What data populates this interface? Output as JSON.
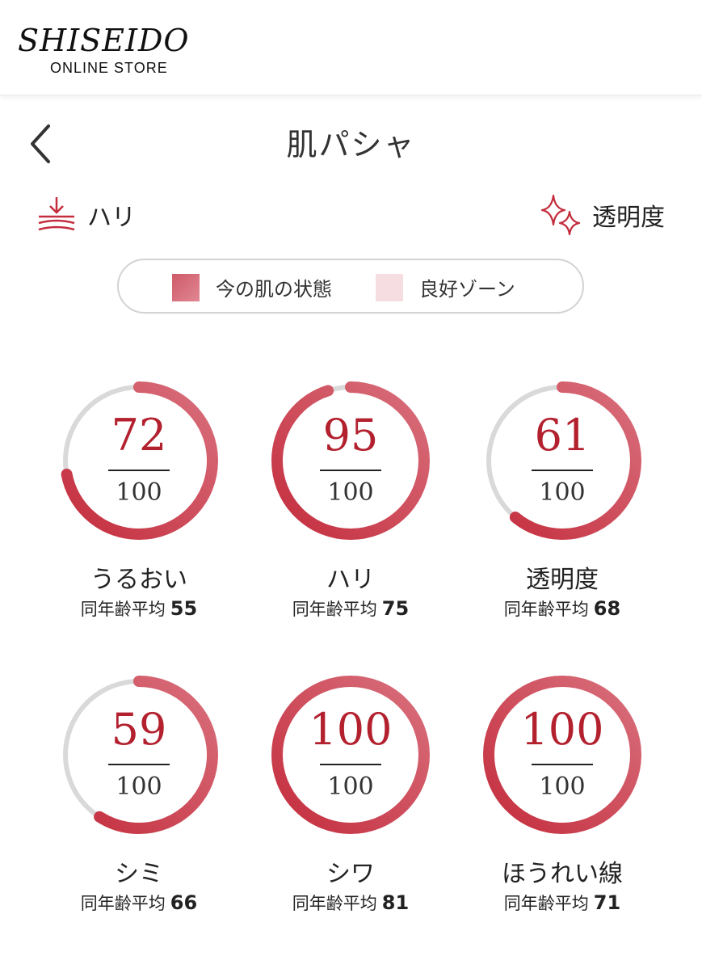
{
  "header": {
    "logo_main": "SHISEIDO",
    "logo_sub": "ONLINE STORE"
  },
  "page": {
    "title": "肌パシャ",
    "back_icon": "chevron-left-icon"
  },
  "nav": {
    "left": {
      "label": "ハリ",
      "icon": "firmness-icon"
    },
    "right": {
      "label": "透明度",
      "icon": "sparkle-icon"
    }
  },
  "legend": {
    "current": {
      "label": "今の肌の状態",
      "color": "#cf5a68"
    },
    "good_zone": {
      "label": "良好ゾーン",
      "color": "#f5dde1"
    }
  },
  "colors": {
    "accent": "#c42d3d",
    "track": "#d9d9d9"
  },
  "metrics": [
    {
      "label": "うるおい",
      "score": "72",
      "max": "100",
      "avg_label": "同年齢平均",
      "avg_value": "55"
    },
    {
      "label": "ハリ",
      "score": "95",
      "max": "100",
      "avg_label": "同年齢平均",
      "avg_value": "75"
    },
    {
      "label": "透明度",
      "score": "61",
      "max": "100",
      "avg_label": "同年齢平均",
      "avg_value": "68"
    },
    {
      "label": "シミ",
      "score": "59",
      "max": "100",
      "avg_label": "同年齢平均",
      "avg_value": "66"
    },
    {
      "label": "シワ",
      "score": "100",
      "max": "100",
      "avg_label": "同年齢平均",
      "avg_value": "81"
    },
    {
      "label": "ほうれい線",
      "score": "100",
      "max": "100",
      "avg_label": "同年齢平均",
      "avg_value": "71"
    }
  ]
}
